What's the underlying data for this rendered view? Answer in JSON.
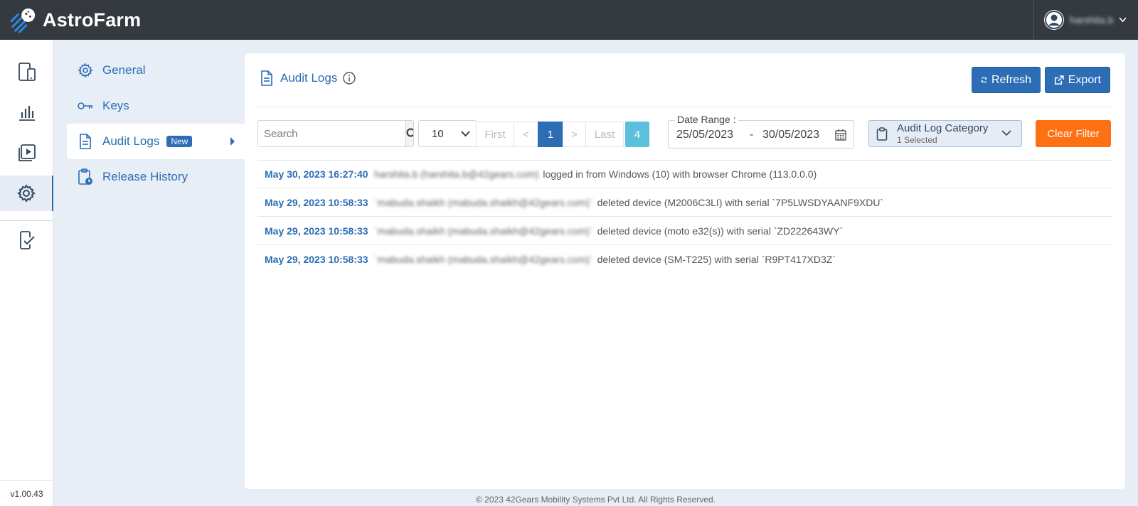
{
  "app": {
    "name": "AstroFarm",
    "version": "v1.00.43",
    "footer": "© 2023 42Gears Mobility Systems Pvt Ltd. All Rights Reserved."
  },
  "user": {
    "name": "harshita.b"
  },
  "rail": {
    "items": [
      {
        "icon": "devices-icon"
      },
      {
        "icon": "analytics-icon"
      },
      {
        "icon": "playback-icon"
      },
      {
        "icon": "settings-gear-icon",
        "active": true
      },
      {
        "icon": "device-check-icon"
      }
    ]
  },
  "submenu": {
    "items": [
      {
        "label": "General",
        "icon": "gear-icon"
      },
      {
        "label": "Keys",
        "icon": "key-icon"
      },
      {
        "label": "Audit Logs",
        "icon": "document-icon",
        "badge": "New",
        "active": true
      },
      {
        "label": "Release History",
        "icon": "clipboard-clock-icon"
      }
    ]
  },
  "panel": {
    "title": "Audit Logs",
    "refresh_label": "Refresh",
    "export_label": "Export"
  },
  "filters": {
    "search_placeholder": "Search",
    "page_size": "10",
    "pager": {
      "first": "First",
      "prev": "<",
      "current": "1",
      "next": ">",
      "last": "Last",
      "total": "4"
    },
    "date_range": {
      "label": "Date Range :",
      "from": "25/05/2023",
      "separator": "-",
      "to": "30/05/2023"
    },
    "category": {
      "title": "Audit Log Category",
      "selected": "1 Selected"
    },
    "clear_label": "Clear Filter"
  },
  "logs": [
    {
      "time": "May 30, 2023 16:27:40",
      "user": "harshita.b (harshita.b@42gears.com)",
      "action": "logged in from Windows (10) with browser Chrome (113.0.0.0)"
    },
    {
      "time": "May 29, 2023 10:58:33",
      "user": "`mabuda.shaikh (mabuda.shaikh@42gears.com)`",
      "action": "deleted device (M2006C3LI) with serial `7P5LWSDYAANF9XDU`"
    },
    {
      "time": "May 29, 2023 10:58:33",
      "user": "`mabuda.shaikh (mabuda.shaikh@42gears.com)`",
      "action": "deleted device (moto e32(s)) with serial `ZD222643WY`"
    },
    {
      "time": "May 29, 2023 10:58:33",
      "user": "`mabuda.shaikh (mabuda.shaikh@42gears.com)`",
      "action": "deleted device (SM-T225) with serial `R9PT417XD3Z`"
    }
  ],
  "colors": {
    "header_bg": "#343a40",
    "accent": "#2c6db5",
    "clear_filter": "#fd7014",
    "page_total": "#5bc0de"
  }
}
